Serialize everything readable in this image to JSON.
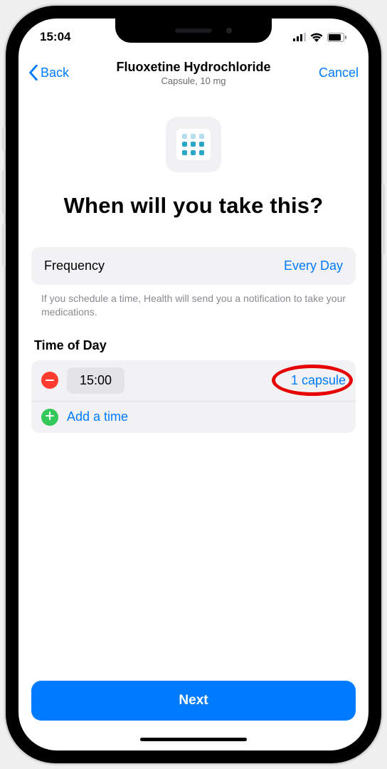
{
  "status": {
    "time": "15:04"
  },
  "nav": {
    "back": "Back",
    "title": "Fluoxetine Hydrochloride",
    "subtitle": "Capsule, 10 mg",
    "cancel": "Cancel"
  },
  "headline": "When will you take this?",
  "frequency": {
    "label": "Frequency",
    "value": "Every Day"
  },
  "help": "If you schedule a time, Health will send you a notification to take your medications.",
  "time_section": {
    "label": "Time of Day",
    "entries": [
      {
        "time": "15:00",
        "dose": "1 capsule"
      }
    ],
    "add_label": "Add a time"
  },
  "next": "Next"
}
